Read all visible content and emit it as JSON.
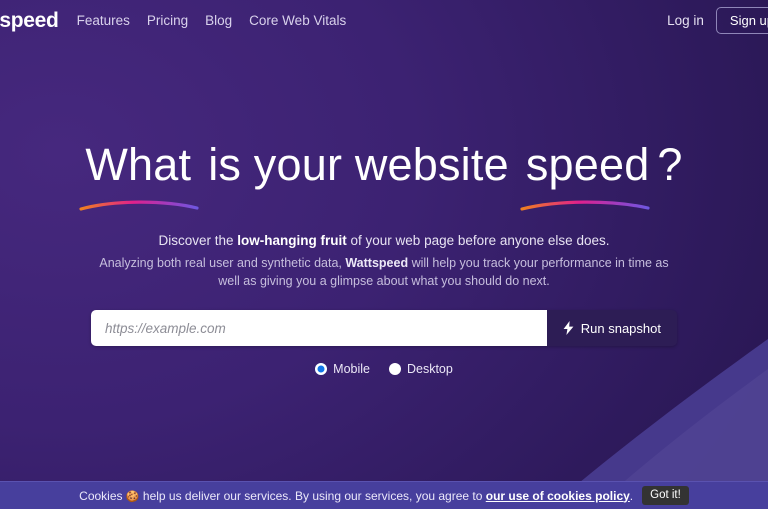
{
  "nav": {
    "brand": "ttspeed",
    "links": [
      {
        "label": "Features"
      },
      {
        "label": "Pricing"
      },
      {
        "label": "Blog"
      },
      {
        "label": "Core Web Vitals"
      }
    ],
    "login_label": "Log in",
    "signup_label": "Sign up"
  },
  "hero": {
    "headline": {
      "word1": "What",
      "word2": "is your website",
      "word3": "speed",
      "qmark": "?"
    },
    "subtitle_1": {
      "before": "Discover the ",
      "strong": "low-hanging fruit",
      "after": " of your web page before anyone else does."
    },
    "subtitle_2": {
      "before": "Analyzing both real user and synthetic data, ",
      "strong": "Wattspeed",
      "after": " will help you track your performance in time as well as giving you a glimpse about what you should do next."
    },
    "search": {
      "placeholder": "https://example.com",
      "value": "",
      "button_label": "Run snapshot",
      "button_icon": "lightning-bolt-icon"
    },
    "device_options": [
      {
        "label": "Mobile",
        "selected": true
      },
      {
        "label": "Desktop",
        "selected": false
      }
    ]
  },
  "cookie_banner": {
    "emoji": "🍪",
    "text_before": "Cookies",
    "text_middle": "help us deliver our services. By using our services, you agree to",
    "policy_link": "our use of cookies policy",
    "text_after": ".",
    "accept_label": "Got it!"
  },
  "colors": {
    "background_light": "#46287e",
    "background_dark": "#241449",
    "accent_blue": "#1277e8",
    "underline_start": "#f08020",
    "underline_mid": "#e0208c",
    "underline_end": "#6f57e0",
    "cookie_bar": "#473f9d",
    "button_dark": "#2d1d55"
  }
}
